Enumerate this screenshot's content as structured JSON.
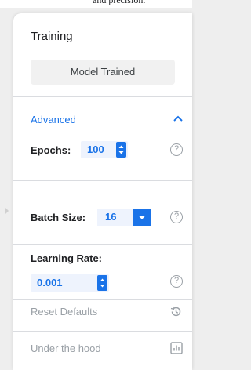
{
  "top_strip": {
    "text": "and precision."
  },
  "panel": {
    "title": "Training",
    "status_button": "Model Trained",
    "advanced": {
      "label": "Advanced",
      "icon": "chevron-up-icon",
      "expanded": true
    },
    "epochs": {
      "label": "Epochs:",
      "value": "100"
    },
    "batch_size": {
      "label": "Batch Size:",
      "value": "16"
    },
    "learning_rate": {
      "label": "Learning Rate:",
      "value": "0.001"
    },
    "help_glyph": "?",
    "reset": {
      "label": "Reset Defaults",
      "icon": "history-icon"
    },
    "under_the_hood": {
      "label": "Under the hood",
      "icon": "bar-chart-icon"
    }
  },
  "colors": {
    "accent": "#1a73e8",
    "muted": "#9aa0a6",
    "field_bg": "#eef3fd"
  }
}
